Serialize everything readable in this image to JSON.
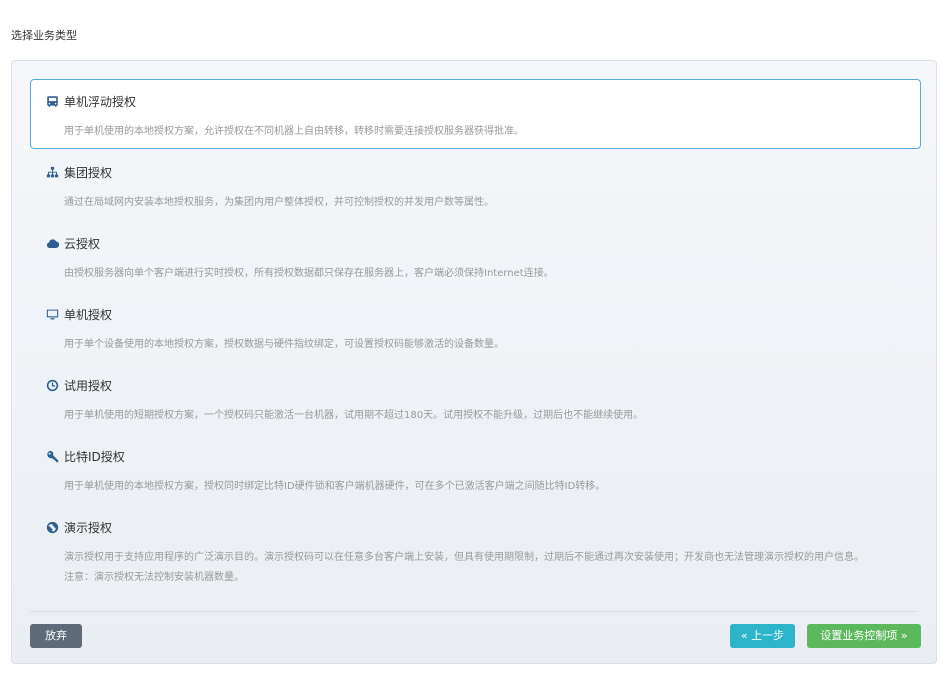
{
  "page": {
    "title": "选择业务类型"
  },
  "options": [
    {
      "icon": "bus-icon",
      "title": "单机浮动授权",
      "desc": "用于单机使用的本地授权方案，允许授权在不同机器上自由转移，转移时需要连接授权服务器获得批准。",
      "selected": true
    },
    {
      "icon": "sitemap-icon",
      "title": "集团授权",
      "desc": "通过在局域网内安装本地授权服务，为集团内用户整体授权，并可控制授权的并发用户数等属性。",
      "selected": false
    },
    {
      "icon": "cloud-icon",
      "title": "云授权",
      "desc": "由授权服务器向单个客户端进行实时授权，所有授权数据都只保存在服务器上，客户端必须保持Internet连接。",
      "selected": false
    },
    {
      "icon": "monitor-icon",
      "title": "单机授权",
      "desc": "用于单个设备使用的本地授权方案，授权数据与硬件指纹绑定，可设置授权码能够激活的设备数量。",
      "selected": false
    },
    {
      "icon": "clock-icon",
      "title": "试用授权",
      "desc": "用于单机使用的短期授权方案，一个授权码只能激活一台机器，试用期不超过180天。试用授权不能升级，过期后也不能继续使用。",
      "selected": false
    },
    {
      "icon": "key-icon",
      "title": "比特ID授权",
      "desc": "用于单机使用的本地授权方案，授权同时绑定比特ID硬件锁和客户端机器硬件，可在多个已激活客户端之间随比特ID转移。",
      "selected": false
    },
    {
      "icon": "globe-icon",
      "title": "演示授权",
      "desc": "演示授权用于支持应用程序的广泛演示目的。演示授权码可以在任意多台客户端上安装，但具有使用期限制，过期后不能通过再次安装使用；开发商也无法管理演示授权的用户信息。",
      "desc2": "注意：演示授权无法控制安装机器数量。",
      "selected": false
    }
  ],
  "buttons": {
    "abandon": "放弃",
    "prev": "« 上一步",
    "next": "设置业务控制项 »"
  },
  "colors": {
    "accent": "#5aa9df",
    "icon": "#2f5f92",
    "abandon": "#5e6a78",
    "prev": "#2cb4c9",
    "next": "#5cb85c"
  }
}
